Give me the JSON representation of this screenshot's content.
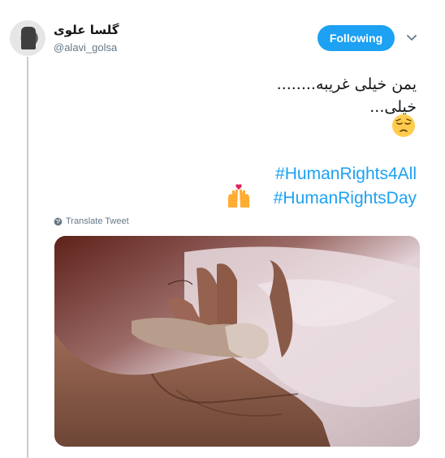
{
  "user": {
    "display_name": "گلسا علوی",
    "handle": "@alavi_golsa"
  },
  "follow_button": {
    "label": "Following"
  },
  "tweet": {
    "line1": "یمن خیلی غریبه........",
    "line2": "خیلی...",
    "emoji": "pensive-face",
    "hashtag1": "#HumanRights4All",
    "hashtag2": "#HumanRightsDay",
    "hashtag2_emoji": "raising-hands-with-heart",
    "translate_label": "Translate Tweet"
  },
  "photo": {
    "alt": "adult hand holding a tiny infant hand"
  },
  "colors": {
    "accent": "#1da1f2",
    "muted": "#657786",
    "thread_line": "#c4cfd6",
    "text": "#14171a"
  }
}
